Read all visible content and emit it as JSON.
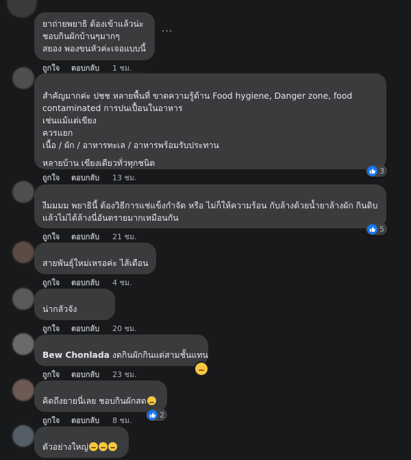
{
  "actions": {
    "like": "ถูกใจ",
    "reply": "ตอบกลับ"
  },
  "more_dots": "···",
  "comments": [
    {
      "lines": [
        "ยาถ่ายพยาธิ ต้องเข้าแล้วน่ะ",
        "ชอบกินผักบ้านๆมากๆ",
        "สยอง พองขนหัวค่ะเจอแบบนี้"
      ],
      "time": "1 ชม."
    },
    {
      "lines": [
        "สำคัญมากค่ะ ปชช หลายพื้นที่ ขาดความรู้ด้าน Food hygiene, Danger zone, food",
        "contaminated การปนเปื้อนในอาหาร",
        "เช่นแม้แต่เขียง",
        "ควรแยก",
        "เนื้อ / ผัก / อาหารทะเล / อาหารพร้อมรับประทาน"
      ],
      "extra": "หลายบ้าน เขียงเดียวทั่วทุกชนิด",
      "time": "13 ชม.",
      "reactions": "3"
    },
    {
      "lines": [
        "งืมมมม พยาธินี้ ต้องวิธีการแช่แข็งกำจัด หรือ ไม่ก็ให้ความร้อน กับล้างด้วยน้ำยาล้างผัก กินดิบ",
        "แล้วไม่ได้ล้างนี่อันตรายมากเหมือนกัน"
      ],
      "time": "21 ชม.",
      "reactions": "5"
    },
    {
      "lines": [
        "สายพันธุ์ใหม่เหรอค่ะ ไส้เดือน"
      ],
      "time": "4 ชม."
    },
    {
      "lines": [
        "น่ากลัวจัง"
      ],
      "time": "20 ชม."
    },
    {
      "author": "Bew Chonlada",
      "text": "งดกินผักกินแต่สามชั้นแทน",
      "time": "23 ชม."
    },
    {
      "lines": [
        "คิดถึงยายนี่เลย ชอบกินผักสด"
      ],
      "time": "8 ชม.",
      "reactions": "2"
    },
    {
      "lines": [
        "ตัวอย่างใหญ่"
      ]
    }
  ],
  "colors": {
    "background": "#18191a",
    "bubble": "#3a3b3c",
    "text": "#e4e6eb",
    "muted": "#b0b3b8",
    "like_blue": "#1877f2"
  }
}
